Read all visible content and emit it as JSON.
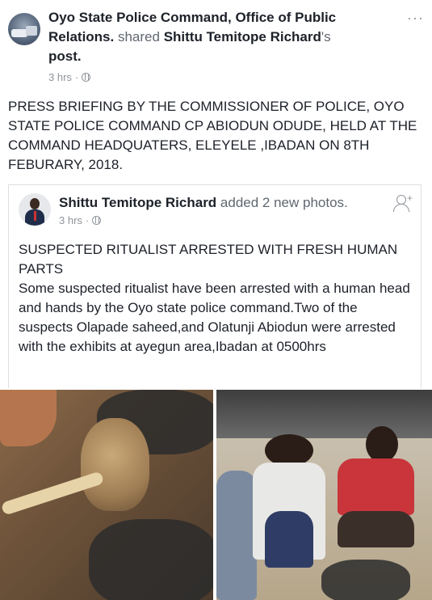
{
  "post": {
    "page_name": "Oyo State Police Command, Office of Public Relations.",
    "shared_word": " shared ",
    "shared_author": "Shittu Temitope Richard",
    "possessive": "'s",
    "post_word": "post.",
    "time": "3 hrs",
    "separator": " · ",
    "more_icon": "···",
    "text": "PRESS BRIEFING BY THE COMMISSIONER OF POLICE, OYO STATE POLICE COMMAND CP ABIODUN ODUDE, HELD AT THE COMMAND HEADQUATERS, ELEYELE ,IBADAN ON 8TH FEBURARY, 2018."
  },
  "shared_post": {
    "author": "Shittu Temitope Richard",
    "action": " added 2 new photos.",
    "time": "3 hrs",
    "separator": " · ",
    "add_friend_plus": "+",
    "headline": "SUSPECTED RITUALIST ARRESTED WITH FRESH HUMAN PARTS",
    "body": "Some suspected ritualist have been arrested with a human head and hands by the Oyo state police command.Two of the suspects Olapade saheed,and Olatunji Abiodun were arrested with the exhibits at ayegun area,Ibadan at 0500hrs"
  },
  "icons": {
    "privacy": "globe-icon",
    "more": "more-options-icon",
    "add_friend": "add-friend-icon"
  },
  "colors": {
    "text": "#1d2129",
    "secondary": "#606770",
    "meta": "#90949c",
    "border": "#dddfe2"
  }
}
